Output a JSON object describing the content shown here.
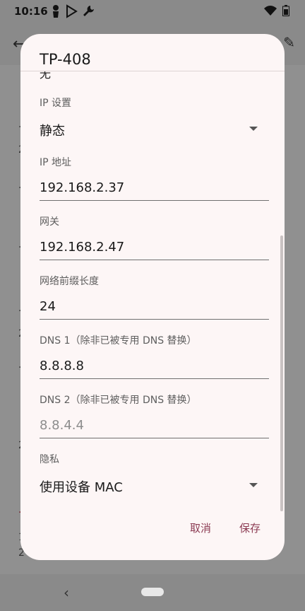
{
  "status_bar": {
    "time": "10:16",
    "icons": [
      "person-icon",
      "play-store-icon",
      "wrench-icon",
      "wifi-icon",
      "battery-icon"
    ]
  },
  "background_app": {
    "fragments": [
      "·",
      "2",
      "·",
      "·",
      "·",
      "2",
      "·",
      "2",
      "·",
      "1",
      "2"
    ]
  },
  "dialog": {
    "title": "TP-408",
    "clipped_value": "无",
    "fields": [
      {
        "label": "IP 设置",
        "value": "静态",
        "type": "dropdown"
      },
      {
        "label": "IP 地址",
        "value": "192.168.2.37",
        "type": "text"
      },
      {
        "label": "网关",
        "value": "192.168.2.47",
        "type": "text"
      },
      {
        "label": "网络前缀长度",
        "value": "24",
        "type": "text"
      },
      {
        "label": "DNS 1（除非已被专用 DNS 替换）",
        "value": "8.8.8.8",
        "type": "text"
      },
      {
        "label": "DNS 2（除非已被专用 DNS 替换）",
        "placeholder": "8.8.4.4",
        "type": "text"
      },
      {
        "label": "隐私",
        "value": "使用设备 MAC",
        "type": "dropdown"
      }
    ],
    "actions": {
      "cancel": "取消",
      "save": "保存"
    }
  },
  "nav_bar": {
    "back": "‹"
  },
  "colors": {
    "accent": "#8c3b53",
    "dialog_bg": "#fdf6f6",
    "scrim": "#8a8a8a"
  }
}
